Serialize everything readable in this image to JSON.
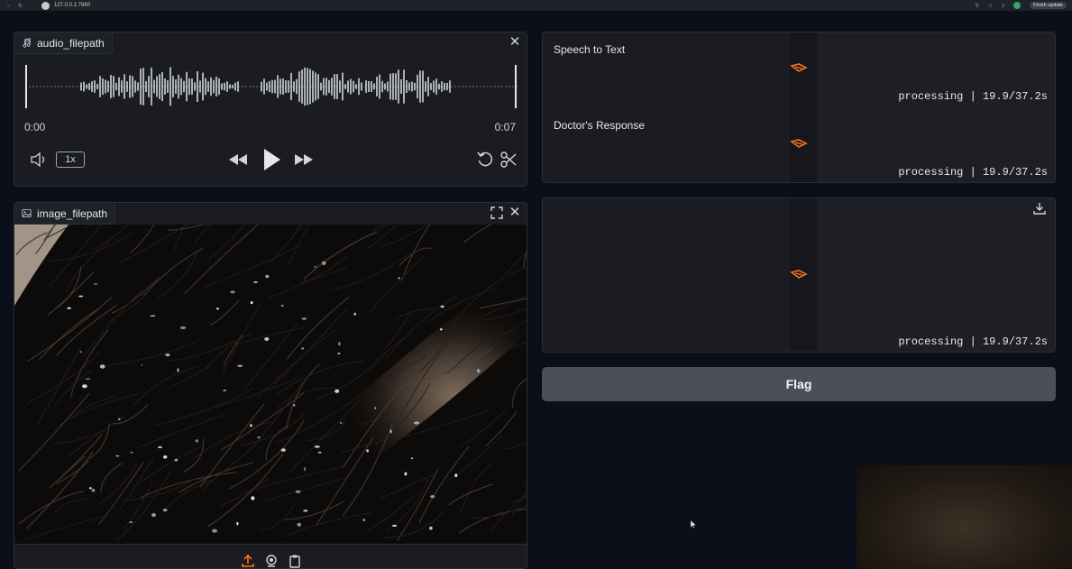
{
  "browser": {
    "url": "127.0.0.1:7860",
    "finish_update": "Finish update"
  },
  "audio_input": {
    "label": "audio_filepath",
    "time_start": "0:00",
    "time_end": "0:07",
    "speed": "1x"
  },
  "image_input": {
    "label": "image_filepath"
  },
  "outputs": {
    "speech_to_text": {
      "label": "Speech to Text",
      "status": "processing | 19.9/37.2s"
    },
    "doctor_response": {
      "label": "Doctor's Response",
      "status": "processing | 19.9/37.2s"
    },
    "audio_output": {
      "status": "processing | 19.9/37.2s"
    }
  },
  "flag_button": {
    "label": "Flag"
  },
  "colors": {
    "background": "#0b0f19",
    "panel": "#1a1c22",
    "accent": "#f97316",
    "flag_button": "#4b4f59"
  }
}
